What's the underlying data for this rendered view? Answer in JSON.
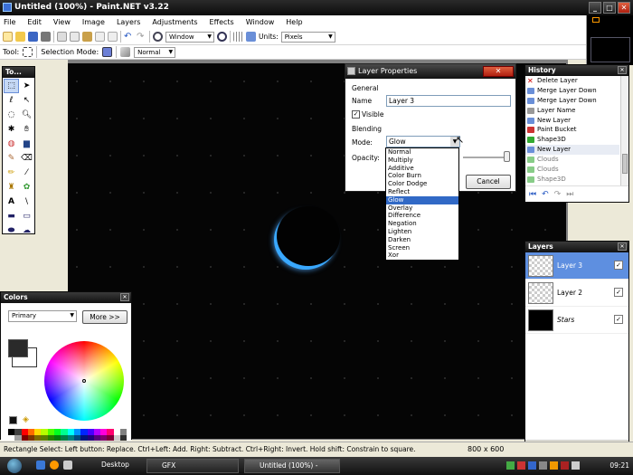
{
  "window": {
    "title": "Untitled (100%) - Paint.NET v3.22"
  },
  "menu": [
    "File",
    "Edit",
    "View",
    "Image",
    "Layers",
    "Adjustments",
    "Effects",
    "Window",
    "Help"
  ],
  "toolbar": {
    "zoom_value": "Window",
    "units_label": "Units:",
    "units_value": "Pixels"
  },
  "toolbar2": {
    "tool_label": "Tool:",
    "selection_mode_label": "Selection Mode:",
    "blend_value": "Normal"
  },
  "tools_panel": {
    "title": "To..."
  },
  "colors_panel": {
    "title": "Colors",
    "mode": "Primary",
    "more_button": "More >>"
  },
  "layer_properties": {
    "title": "Layer Properties",
    "general_label": "General",
    "name_label": "Name",
    "name_value": "Layer 3",
    "visible_label": "Visible",
    "blending_label": "Blending",
    "mode_label": "Mode:",
    "mode_value": "Glow",
    "opacity_label": "Opacity:",
    "cancel_button": "Cancel",
    "mode_options": [
      "Normal",
      "Multiply",
      "Additive",
      "Color Burn",
      "Color Dodge",
      "Reflect",
      "Glow",
      "Overlay",
      "Difference",
      "Negation",
      "Lighten",
      "Darken",
      "Screen",
      "Xor"
    ],
    "selected_option": "Glow"
  },
  "history": {
    "title": "History",
    "items": [
      {
        "label": "Delete Layer",
        "icon": "delete-icon",
        "state": "active"
      },
      {
        "label": "Merge Layer Down",
        "icon": "merge-icon",
        "state": "active"
      },
      {
        "label": "Merge Layer Down",
        "icon": "merge-icon",
        "state": "active"
      },
      {
        "label": "Layer Name",
        "icon": "layer-properties-icon",
        "state": "active"
      },
      {
        "label": "New Layer",
        "icon": "new-layer-icon",
        "state": "active"
      },
      {
        "label": "Paint Bucket",
        "icon": "paint-bucket-icon",
        "state": "active"
      },
      {
        "label": "Shape3D",
        "icon": "effect-icon",
        "state": "active"
      },
      {
        "label": "New Layer",
        "icon": "new-layer-icon",
        "state": "active"
      },
      {
        "label": "Clouds",
        "icon": "effect-icon",
        "state": "undone"
      },
      {
        "label": "Clouds",
        "icon": "effect-icon",
        "state": "undone"
      },
      {
        "label": "Shape3D",
        "icon": "effect-icon",
        "state": "undone"
      }
    ]
  },
  "layers": {
    "title": "Layers",
    "items": [
      {
        "name": "Layer 3",
        "visible": true,
        "selected": true
      },
      {
        "name": "Layer 2",
        "visible": true,
        "selected": false
      },
      {
        "name": "Stars",
        "visible": true,
        "selected": false
      }
    ]
  },
  "status": {
    "hint": "Rectangle Select: Left button: Replace. Ctrl+Left: Add. Right: Subtract. Ctrl+Right: Invert. Hold shift: Constrain to square.",
    "image_size": "800 x 600"
  },
  "taskbar": {
    "tasks": [
      "Desktop",
      "GFX",
      "Untitled (100%) - Paint..."
    ],
    "clock": "09:21"
  },
  "colors": {
    "accent": "#3169c6",
    "glow": "#39a8ff"
  }
}
